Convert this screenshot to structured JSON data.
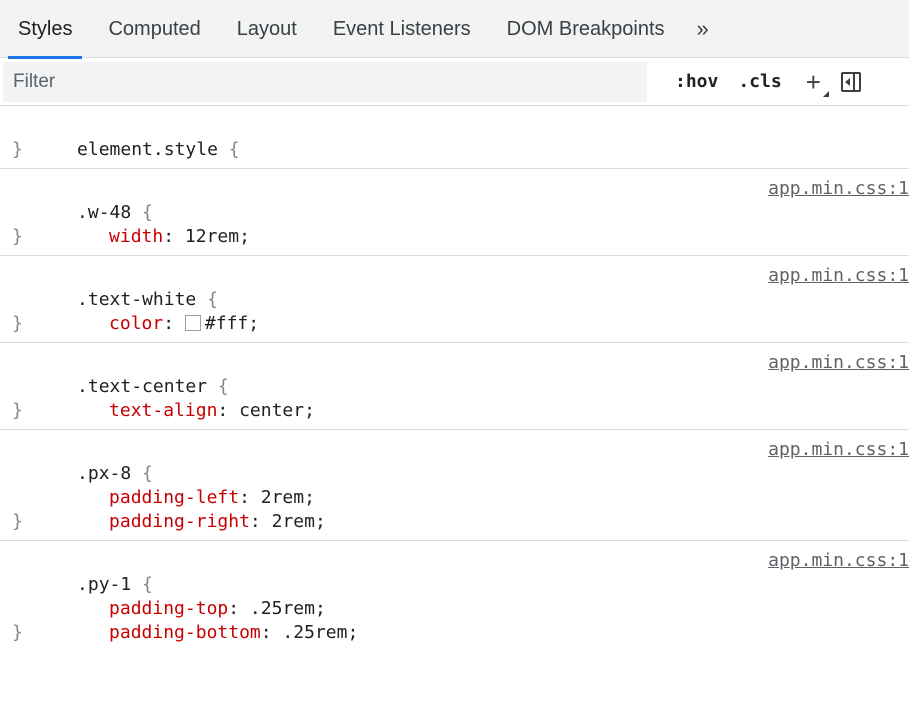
{
  "tabs": {
    "items": [
      "Styles",
      "Computed",
      "Layout",
      "Event Listeners",
      "DOM Breakpoints"
    ],
    "active": "Styles",
    "more_label": "»"
  },
  "filter": {
    "placeholder": "Filter",
    "hov_label": ":hov",
    "cls_label": ".cls",
    "plus_label": "+"
  },
  "rules": {
    "element_style": {
      "selector": "element.style",
      "open": " {",
      "close": "}"
    },
    "w48": {
      "selector": ".w-48",
      "open": " {",
      "close": "}",
      "source": "app.min.css:1",
      "decls": [
        {
          "prop": "width",
          "val": " 12rem;"
        }
      ]
    },
    "text_white": {
      "selector": ".text-white",
      "open": " {",
      "close": "}",
      "source": "app.min.css:1",
      "decls": [
        {
          "prop": "color",
          "val": "#fff;",
          "swatch": "#ffffff"
        }
      ]
    },
    "text_center": {
      "selector": ".text-center",
      "open": " {",
      "close": "}",
      "source": "app.min.css:1",
      "decls": [
        {
          "prop": "text-align",
          "val": " center;"
        }
      ]
    },
    "px8": {
      "selector": ".px-8",
      "open": " {",
      "close": "}",
      "source": "app.min.css:1",
      "decls": [
        {
          "prop": "padding-left",
          "val": " 2rem;"
        },
        {
          "prop": "padding-right",
          "val": " 2rem;"
        }
      ]
    },
    "py1": {
      "selector": ".py-1",
      "open": " {",
      "close": "}",
      "source": "app.min.css:1",
      "decls": [
        {
          "prop": "padding-top",
          "val": " .25rem;"
        },
        {
          "prop": "padding-bottom",
          "val": " .25rem;"
        }
      ]
    }
  },
  "colors": {
    "accent": "#1a73e8",
    "property": "#c80000",
    "brace": "#80868b",
    "source_link": "#5f6368"
  }
}
